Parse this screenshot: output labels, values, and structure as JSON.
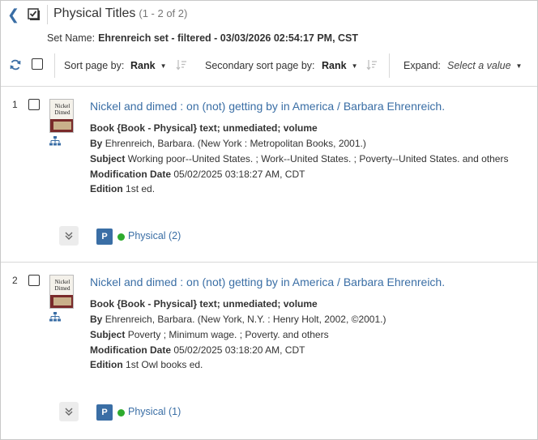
{
  "header": {
    "title": "Physical Titles",
    "count": "(1 - 2 of 2)",
    "set_name_label": "Set Name:",
    "set_name_value": "Ehrenreich set - filtered - 03/03/2026 02:54:17 PM, CST"
  },
  "toolbar": {
    "sort_label": "Sort page by:",
    "sort_value": "Rank",
    "secondary_sort_label": "Secondary sort page by:",
    "secondary_sort_value": "Rank",
    "expand_label": "Expand:",
    "expand_placeholder": "Select a value"
  },
  "records": [
    {
      "number": "1",
      "title": "Nickel and dimed : on (not) getting by in America / Barbara Ehrenreich.",
      "format": "Book {Book - Physical} text; unmediated; volume",
      "by_label": "By",
      "by_value": "Ehrenreich, Barbara. (New York : Metropolitan Books, 2001.)",
      "subject_label": "Subject",
      "subject_value": "Working poor--United States. ; Work--United States. ; Poverty--United States. and others",
      "mod_label": "Modification Date",
      "mod_value": "05/02/2025 03:18:27 AM, CDT",
      "edition_label": "Edition",
      "edition_value": "1st ed.",
      "badge": "P",
      "inventory": "Physical (2)",
      "cover_title": "Nickel and Dimed"
    },
    {
      "number": "2",
      "title": "Nickel and dimed : on (not) getting by in America / Barbara Ehrenreich.",
      "format": "Book {Book - Physical} text; unmediated; volume",
      "by_label": "By",
      "by_value": "Ehrenreich, Barbara. (New York, N.Y. : Henry Holt, 2002, ©2001.)",
      "subject_label": "Subject",
      "subject_value": "Poverty ; Minimum wage. ; Poverty. and others",
      "mod_label": "Modification Date",
      "mod_value": "05/02/2025 03:18:20 AM, CDT",
      "edition_label": "Edition",
      "edition_value": "1st Owl books ed.",
      "badge": "P",
      "inventory": "Physical (1)",
      "cover_title": "Nickel and Dimed"
    }
  ],
  "colors": {
    "link": "#3a6ea5",
    "badge": "#3a6ea5",
    "available_dot": "#2eab2e"
  },
  "icons": {
    "back": "chevron-left-icon",
    "select_all_menu": "checkbox-menu-icon",
    "refresh": "refresh-icon",
    "sort_direction": "sort-order-icon",
    "hierarchy": "hierarchy-icon",
    "expand": "double-chevron-down-icon"
  }
}
